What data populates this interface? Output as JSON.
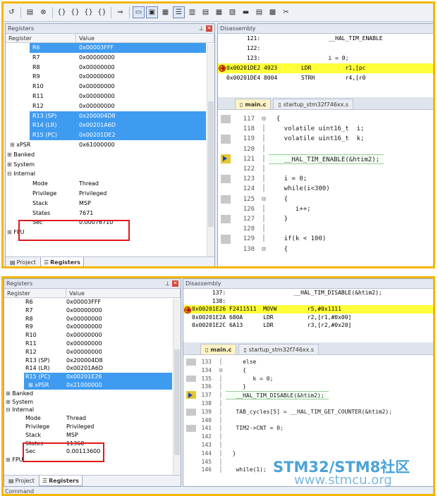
{
  "panels": [
    {
      "registers_title": "Registers",
      "disasm_title": "Disassembly",
      "col_register": "Register",
      "col_value": "Value",
      "rows": [
        {
          "name": "R6",
          "value": "0x00003FFF",
          "sel": true,
          "indent": 2
        },
        {
          "name": "R7",
          "value": "0x00000000",
          "indent": 2
        },
        {
          "name": "R8",
          "value": "0x00000000",
          "indent": 2
        },
        {
          "name": "R9",
          "value": "0x00000000",
          "indent": 2
        },
        {
          "name": "R10",
          "value": "0x00000000",
          "indent": 2
        },
        {
          "name": "R11",
          "value": "0x00000000",
          "indent": 2
        },
        {
          "name": "R12",
          "value": "0x00000000",
          "indent": 2
        },
        {
          "name": "R13 (SP)",
          "value": "0x200004D8",
          "sel": true,
          "indent": 2
        },
        {
          "name": "R14 (LR)",
          "value": "0x00201A6D",
          "sel": true,
          "indent": 2
        },
        {
          "name": "R15 (PC)",
          "value": "0x00201DE2",
          "sel": true,
          "indent": 2
        },
        {
          "name": "xPSR",
          "value": "0x61000000",
          "indent": 1,
          "exp": "+"
        },
        {
          "name": "Banked",
          "value": "",
          "indent": 0,
          "exp": "+"
        },
        {
          "name": "System",
          "value": "",
          "indent": 0,
          "exp": "+"
        },
        {
          "name": "Internal",
          "value": "",
          "indent": 0,
          "exp": "-"
        },
        {
          "name": "Mode",
          "value": "Thread",
          "indent": 2
        },
        {
          "name": "Privilege",
          "value": "Privileged",
          "indent": 2
        },
        {
          "name": "Stack",
          "value": "MSP",
          "indent": 2
        },
        {
          "name": "States",
          "value": "7671",
          "indent": 2
        },
        {
          "name": "Sec",
          "value": "0.00076710",
          "indent": 2
        },
        {
          "name": "FPU",
          "value": "",
          "indent": 0,
          "exp": "+"
        }
      ],
      "disasm": [
        {
          "text": "      121:                    __HAL_TIM_ENABLE"
        },
        {
          "text": "      122:"
        },
        {
          "text": "      123:                    i = 0;"
        },
        {
          "text": "0x00201DE2 4923       LDR          r1,[pc",
          "hl": true,
          "arrow": true
        },
        {
          "text": "0x00201DE4 8004       STRH         r4,[r0"
        }
      ],
      "tabs": {
        "main": "main.c",
        "startup": "startup_stm32f746xx.s"
      },
      "code": [
        {
          "num": "117",
          "fold": "-",
          "src": "  {"
        },
        {
          "num": "118",
          "src": "    volatile uint16_t  i;"
        },
        {
          "num": "119",
          "src": "    volatile uint16_t  k;"
        },
        {
          "num": "120",
          "src": ""
        },
        {
          "num": "121",
          "src": "    __HAL_TIM_ENABLE(&htim2);",
          "cur": true
        },
        {
          "num": "122",
          "src": ""
        },
        {
          "num": "123",
          "src": "    i = 0;"
        },
        {
          "num": "124",
          "src": "    while(i<300)"
        },
        {
          "num": "125",
          "fold": "-",
          "src": "    {"
        },
        {
          "num": "126",
          "src": "       i++;"
        },
        {
          "num": "127",
          "src": "    }"
        },
        {
          "num": "128",
          "src": ""
        },
        {
          "num": "129",
          "src": "    if(k < 100)"
        },
        {
          "num": "130",
          "fold": "-",
          "src": "    {"
        }
      ],
      "bottom_tabs": {
        "project": "Project",
        "registers": "Registers"
      }
    },
    {
      "registers_title": "Registers",
      "disasm_title": "Disassembly",
      "col_register": "Register",
      "col_value": "Value",
      "rows": [
        {
          "name": "R6",
          "value": "0x00003FFF",
          "indent": 2
        },
        {
          "name": "R7",
          "value": "0x00000000",
          "indent": 2
        },
        {
          "name": "R8",
          "value": "0x00000000",
          "indent": 2
        },
        {
          "name": "R9",
          "value": "0x00000000",
          "indent": 2
        },
        {
          "name": "R10",
          "value": "0x00000000",
          "indent": 2
        },
        {
          "name": "R11",
          "value": "0x00000000",
          "indent": 2
        },
        {
          "name": "R12",
          "value": "0x00000000",
          "indent": 2
        },
        {
          "name": "R13 (SP)",
          "value": "0x200004D8",
          "indent": 2
        },
        {
          "name": "R14 (LR)",
          "value": "0x00201A6D",
          "indent": 2
        },
        {
          "name": "R15 (PC)",
          "value": "0x00201E26",
          "sel": true,
          "indent": 2
        },
        {
          "name": "xPSR",
          "value": "0x21000000",
          "sel": true,
          "indent": 1,
          "exp": "+"
        },
        {
          "name": "Banked",
          "value": "",
          "indent": 0,
          "exp": "+"
        },
        {
          "name": "System",
          "value": "",
          "indent": 0,
          "exp": "+"
        },
        {
          "name": "Internal",
          "value": "",
          "indent": 0,
          "exp": "-"
        },
        {
          "name": "Mode",
          "value": "Thread",
          "indent": 2
        },
        {
          "name": "Privilege",
          "value": "Privileged",
          "indent": 2
        },
        {
          "name": "Stack",
          "value": "MSP",
          "indent": 2
        },
        {
          "name": "States",
          "value": "11360",
          "indent": 2
        },
        {
          "name": "Sec",
          "value": "0.00113600",
          "indent": 2
        },
        {
          "name": "FPU",
          "value": "",
          "indent": 0,
          "exp": "+"
        }
      ],
      "disasm": [
        {
          "text": "      137:                    __HAL_TIM_DISABLE(&htim2);"
        },
        {
          "text": "      138:"
        },
        {
          "text": "0x00201E26 F2411511  MOVW         r5,#0x1111",
          "hl": true,
          "arrow": true
        },
        {
          "text": "0x00201E2A 680A      LDR          r2,[r1,#0x00]"
        },
        {
          "text": "0x00201E2C 6A13      LDR          r3,[r2,#0x20]"
        }
      ],
      "tabs": {
        "main": "main.c",
        "startup": "startup_stm32f746xx.s"
      },
      "code": [
        {
          "num": "133",
          "src": "     else"
        },
        {
          "num": "134",
          "fold": "-",
          "src": "     {"
        },
        {
          "num": "135",
          "src": "        k = 0;"
        },
        {
          "num": "136",
          "src": "     }"
        },
        {
          "num": "137",
          "src": "   __HAL_TIM_DISABLE(&htim2);",
          "cur": true
        },
        {
          "num": "138",
          "src": ""
        },
        {
          "num": "139",
          "src": "   TAB_cycles[5] = __HAL_TIM_GET_COUNTER(&htim2);"
        },
        {
          "num": "140",
          "src": ""
        },
        {
          "num": "141",
          "src": "   TIM2->CNT = 0;"
        },
        {
          "num": "142",
          "src": ""
        },
        {
          "num": "143",
          "src": ""
        },
        {
          "num": "144",
          "src": "  }"
        },
        {
          "num": "145",
          "src": ""
        },
        {
          "num": "146",
          "src": "   while(1);"
        }
      ],
      "bottom_tabs": {
        "project": "Project",
        "registers": "Registers"
      },
      "command": "Command"
    }
  ],
  "watermark": {
    "line1": "STM32/STM8社区",
    "line2": "www.stmcu.org"
  },
  "colors": {
    "frame": "#f5b600",
    "selected": "#3f9bf0",
    "highlight": "#ffff3a",
    "redbox": "#e01818"
  }
}
